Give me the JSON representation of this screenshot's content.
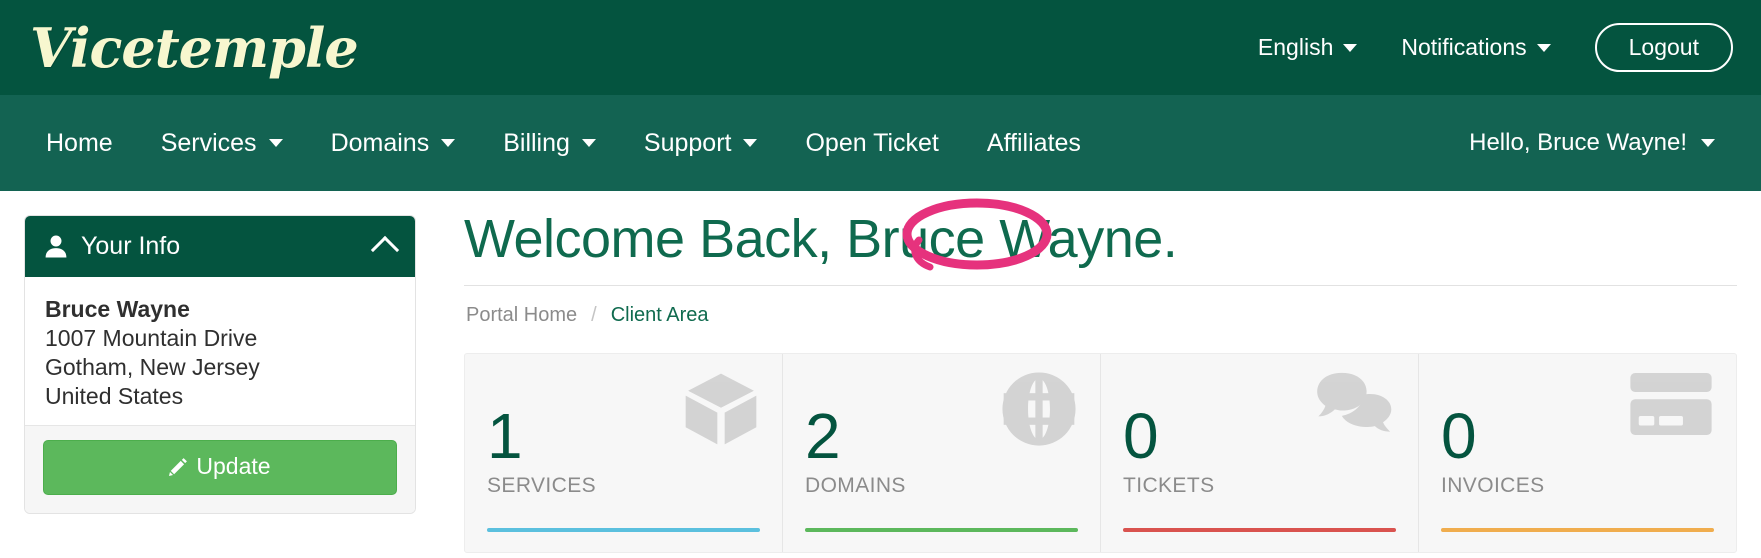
{
  "header": {
    "logo_text": "Vicetemple",
    "language_label": "English",
    "notifications_label": "Notifications",
    "logout_label": "Logout",
    "bg_color": "#04543f"
  },
  "nav": {
    "bg_color": "#136352",
    "items": [
      {
        "label": "Home",
        "has_caret": false
      },
      {
        "label": "Services",
        "has_caret": true
      },
      {
        "label": "Domains",
        "has_caret": true
      },
      {
        "label": "Billing",
        "has_caret": true
      },
      {
        "label": "Support",
        "has_caret": true
      },
      {
        "label": "Open Ticket",
        "has_caret": false
      },
      {
        "label": "Affiliates",
        "has_caret": false
      }
    ],
    "greeting": "Hello, Bruce Wayne!",
    "annotation": {
      "target": "Affiliates",
      "shape": "ellipse",
      "color": "#e6327d"
    }
  },
  "sidebar": {
    "panel_title": "Your Info",
    "client_name": "Bruce Wayne",
    "address_line1": "1007 Mountain Drive",
    "address_line2": "Gotham, New Jersey",
    "address_line3": "United States",
    "update_label": "Update"
  },
  "main": {
    "page_title": "Welcome Back, Bruce Wayne.",
    "breadcrumb": {
      "home": "Portal Home",
      "separator": "/",
      "current": "Client Area"
    },
    "stats": [
      {
        "value": "1",
        "label": "SERVICES",
        "icon": "cube-icon",
        "bar_color": "#5bc0de"
      },
      {
        "value": "2",
        "label": "DOMAINS",
        "icon": "globe-icon",
        "bar_color": "#5cb85c"
      },
      {
        "value": "0",
        "label": "TICKETS",
        "icon": "comments-icon",
        "bar_color": "#d9534f"
      },
      {
        "value": "0",
        "label": "INVOICES",
        "icon": "credit-card-icon",
        "bar_color": "#f0ad4e"
      }
    ]
  }
}
